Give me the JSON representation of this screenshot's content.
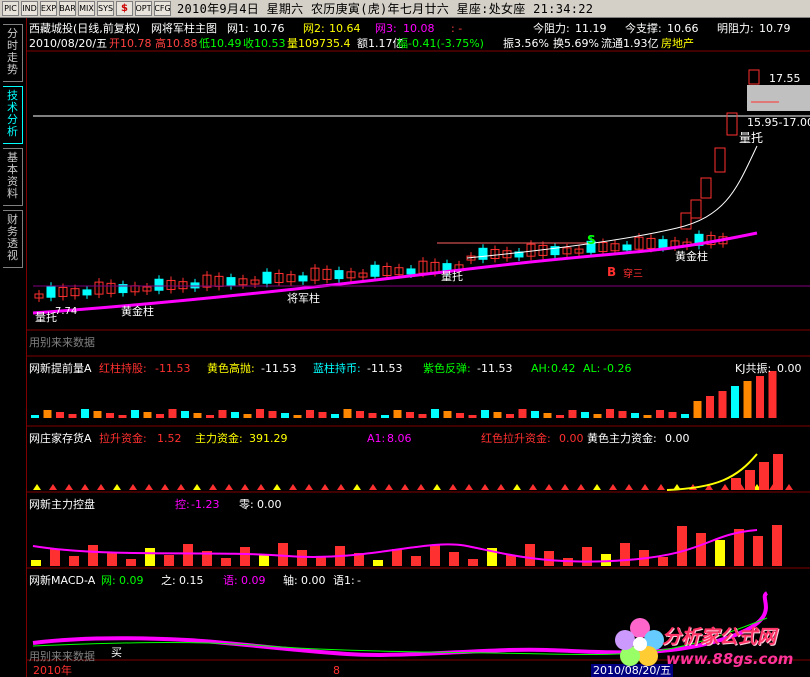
{
  "toolbar": {
    "buttons": [
      "PIC",
      "IND",
      "EXP",
      "BAR",
      "MIX",
      "SYS",
      "$",
      "OPT",
      "CFG"
    ],
    "datetime": "2010年9月4日  星期六  农历庚寅(虎)年七月廿六  星座:处女座  21:34:22"
  },
  "sidetabs": [
    {
      "label": "分时走势"
    },
    {
      "label": "技术分析"
    },
    {
      "label": "基本资料"
    },
    {
      "label": "财务透视"
    }
  ],
  "main": {
    "title": "西藏城投(日线,前复权)",
    "indicator": "网将军柱主图",
    "w1_label": "网1:",
    "w1_value": "10.76",
    "w2_label": "网2:",
    "w2_value": "10.64",
    "w3_label": "网3:",
    "w3_value": "10.08",
    "w3_extra": ": -",
    "resist_label": "今阻力:",
    "resist_value": "11.19",
    "support_label": "今支撑:",
    "support_value": "10.66",
    "tomorrow_label": "明阻力:",
    "tomorrow_value": "10.79",
    "info": {
      "date": "2010/08/20/五",
      "open": "开10.78",
      "high": "高10.88",
      "low": "低10.49",
      "close": "收10.53",
      "vol": "量109735.4",
      "amount": "额1.17亿",
      "change": "幅-0.41(-3.75%)",
      "amplitude": "振3.56%",
      "turnover": "换5.69%",
      "float": "流通1.93亿",
      "sector": "房地产"
    },
    "price_high": "17.55",
    "price_range": "15.95-17.00",
    "labels": {
      "lt1": "量托",
      "jzz1": "黄金柱",
      "jjz": "将军柱",
      "lt2": "量托",
      "jzz2": "黄金柱",
      "lt3": "量托",
      "s": "S",
      "b": "B",
      "kong": "穿三"
    },
    "low_price": "7.74",
    "footer_label": "用别来来数据"
  },
  "panel1": {
    "name": "网新提前量A",
    "a_label": "红柱持股:",
    "a_value": "-11.53",
    "b_label": "黄色高抛:",
    "b_value": "-11.53",
    "c_label": "蓝柱持币:",
    "c_value": "-11.53",
    "d_label": "紫色反弹:",
    "d_value": "-11.53",
    "ah_label": "AH:",
    "ah_value": "0.42",
    "al_label": "AL:",
    "al_value": "-0.26",
    "kj_label": "KJ共振:",
    "kj_value": "0.00"
  },
  "panel2": {
    "name": "网庄家存货A",
    "a_label": "拉升资金:",
    "a_value": "1.52",
    "b_label": "主力资金:",
    "b_value": "391.29",
    "c_label": "A1:",
    "c_value": "8.06",
    "d_label": "红色拉升资金:",
    "d_value": "0.00",
    "e_label": "黄色主力资金:",
    "e_value": "0.00"
  },
  "panel3": {
    "name": "网新主力控盘",
    "a_label": "控:",
    "a_value": "-1.23",
    "b_label": "零:",
    "b_value": "0.00"
  },
  "panel4": {
    "name": "网新MACD-A",
    "a_label": "网:",
    "a_value": "0.09",
    "b_label": "之:",
    "b_value": "0.15",
    "c_label": "语:",
    "c_value": "0.09",
    "d_label": "轴:",
    "d_value": "0.00",
    "e_label": "语1:",
    "e_value": "-",
    "footer_label": "用别来来数据",
    "mai": "买"
  },
  "xaxis": {
    "start": "2010年",
    "mid": "8",
    "end": "2010/08/20/五"
  },
  "watermark": {
    "title": "分析家公式网",
    "url": "www.88gs.com"
  },
  "colors": {
    "up": "#ff3030",
    "down": "#00ffff",
    "ma": "#ff00ff",
    "accent": "#ffff00",
    "green": "#00ff00"
  }
}
